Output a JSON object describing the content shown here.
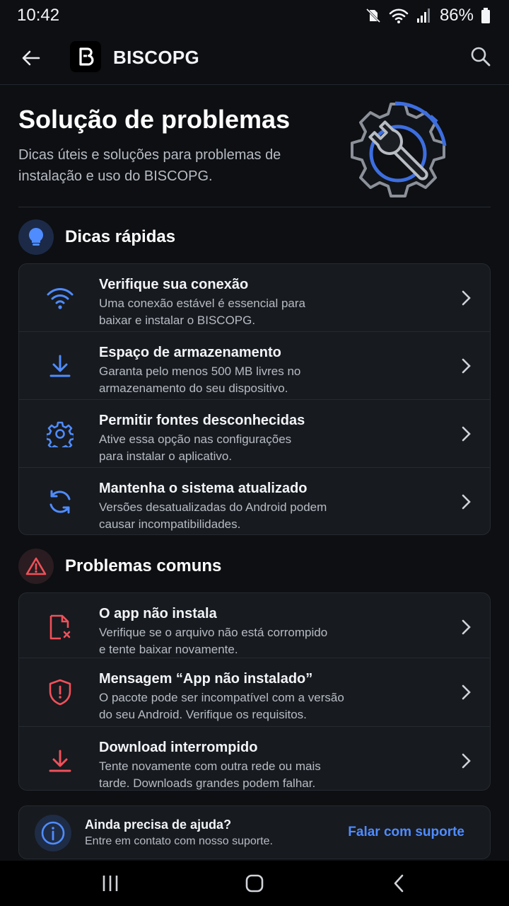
{
  "status_bar": {
    "time": "10:42",
    "battery": "86%"
  },
  "app_bar": {
    "title": "BISCOPG"
  },
  "hero": {
    "title": "Solução de problemas",
    "subtitle": "Dicas úteis e soluções para problemas de instalação e uso do BISCOPG."
  },
  "quick_tips": {
    "title": "Dicas rápidas",
    "items": [
      {
        "title": "Verifique sua conexão",
        "desc_1": "Uma conexão estável é essencial para",
        "desc_2": "baixar e instalar o BISCOPG.",
        "icon": "wifi-icon"
      },
      {
        "title": "Espaço de armazenamento",
        "desc_1": "Garanta pelo menos 500 MB livres no",
        "desc_2": "armazenamento do seu dispositivo.",
        "icon": "download-icon"
      },
      {
        "title": "Permitir fontes desconhecidas",
        "desc_1": "Ative essa opção nas configurações",
        "desc_2": "para instalar o aplicativo.",
        "icon": "gear-icon"
      },
      {
        "title": "Mantenha o sistema atualizado",
        "desc_1": "Versões desatualizadas do Android podem",
        "desc_2": "causar incompatibilidades.",
        "icon": "refresh-icon"
      }
    ]
  },
  "common_problems": {
    "title": "Problemas comuns",
    "items": [
      {
        "title": "O app não instala",
        "desc_1": "Verifique se o arquivo não está corrompido",
        "desc_2": "e tente baixar novamente.",
        "icon": "file-error-icon"
      },
      {
        "title": "Mensagem “App não instalado”",
        "desc_1": "O pacote pode ser incompatível com a versão",
        "desc_2": "do seu Android. Verifique os requisitos.",
        "icon": "shield-alert-icon"
      },
      {
        "title": "Download interrompido",
        "desc_1": "Tente novamente com outra rede ou mais",
        "desc_2": "tarde. Downloads grandes podem falhar.",
        "icon": "download-icon"
      }
    ]
  },
  "help": {
    "title": "Ainda precisa de ajuda?",
    "subtitle": "Entre em contato com nosso suporte.",
    "link": "Falar com suporte"
  },
  "colors": {
    "accent_blue": "#4f8cff",
    "alert_red": "#f0505a",
    "background": "#0d0f12",
    "card": "#171a1f"
  }
}
